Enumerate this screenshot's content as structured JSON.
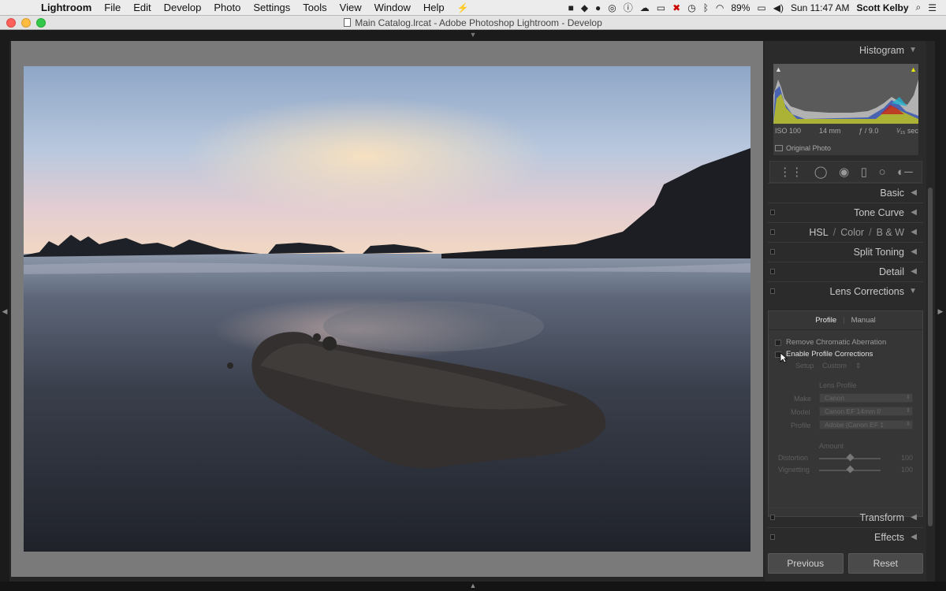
{
  "menubar": {
    "apple_glyph": "",
    "app_name": "Lightroom",
    "items": [
      "File",
      "Edit",
      "Develop",
      "Photo",
      "Settings",
      "Tools",
      "View",
      "Window",
      "Help"
    ],
    "battery": "89%",
    "clock": "Sun 11:47 AM",
    "user": "Scott Kelby"
  },
  "window": {
    "title": "Main Catalog.lrcat - Adobe Photoshop Lightroom - Develop"
  },
  "histogram": {
    "title": "Histogram",
    "iso": "ISO 100",
    "focal": "14 mm",
    "aperture": "ƒ / 9.0",
    "shutter": "¹⁄₁₅ sec",
    "original_photo": "Original Photo"
  },
  "panels": {
    "basic": "Basic",
    "tone_curve": "Tone Curve",
    "hsl": "HSL",
    "color": "Color",
    "bw": "B & W",
    "split_toning": "Split Toning",
    "detail": "Detail",
    "lens_corrections": "Lens Corrections",
    "transform": "Transform",
    "effects": "Effects"
  },
  "lens": {
    "tab_profile": "Profile",
    "tab_manual": "Manual",
    "remove_ca": "Remove Chromatic Aberration",
    "enable_profile": "Enable Profile Corrections",
    "setup_label": "Setup",
    "setup_value": "Custom",
    "lens_profile_heading": "Lens Profile",
    "make_label": "Make",
    "make_value": "Canon",
    "model_label": "Model",
    "model_value": "Canon EF 14mm f/",
    "profile_label": "Profile",
    "profile_value": "Adobe (Canon EF 1",
    "amount_heading": "Amount",
    "distortion_label": "Distortion",
    "distortion_value": "100",
    "vignetting_label": "Vignetting",
    "vignetting_value": "100"
  },
  "buttons": {
    "previous": "Previous",
    "reset": "Reset"
  }
}
